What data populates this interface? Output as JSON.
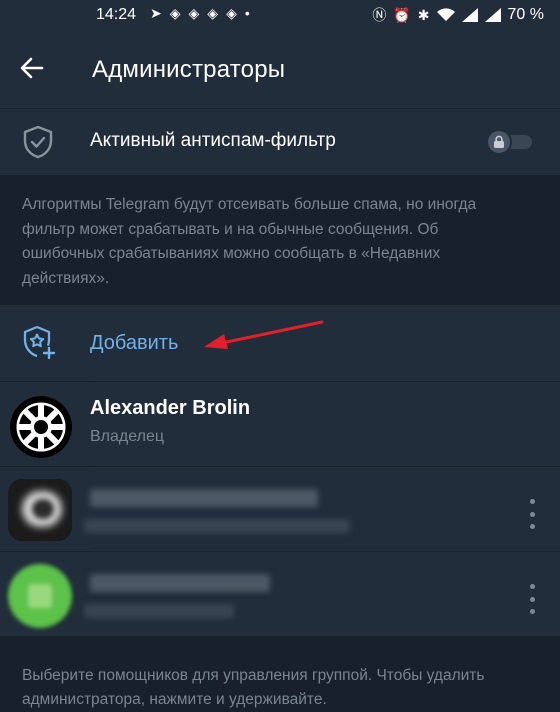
{
  "status_bar": {
    "time": "14:24",
    "battery": "70 %",
    "left_icons": [
      "telegram-icon",
      "cloud-icon",
      "cloud-icon",
      "cloud-icon",
      "cloud-icon",
      "dot-icon"
    ],
    "right_icons": [
      "nfc-icon",
      "alarm-icon",
      "bluetooth-icon",
      "wifi-icon",
      "signal-icon",
      "signal-icon"
    ]
  },
  "header": {
    "title": "Администраторы"
  },
  "antispam": {
    "label": "Активный антиспам-фильтр",
    "enabled": false
  },
  "antispam_hint": "Алгоритмы Telegram будут отсеивать больше спама, но иногда фильтр может срабатывать и на обычные сообщения. Об ошибочных срабатываниях можно сообщать в «Недавних действиях».",
  "add_admin": {
    "label": "Добавить"
  },
  "members": [
    {
      "name": "Alexander Brolin",
      "role": "Владелец"
    }
  ],
  "footer_hint": "Выберите помощников для управления группой. Чтобы удалить администратора, нажмите и удерживайте.",
  "colors": {
    "background": "#17202b",
    "surface": "#212d3b",
    "accent": "#6fb1e8",
    "annotation_arrow": "#e3202a",
    "secondary_text": "#7b8590"
  }
}
